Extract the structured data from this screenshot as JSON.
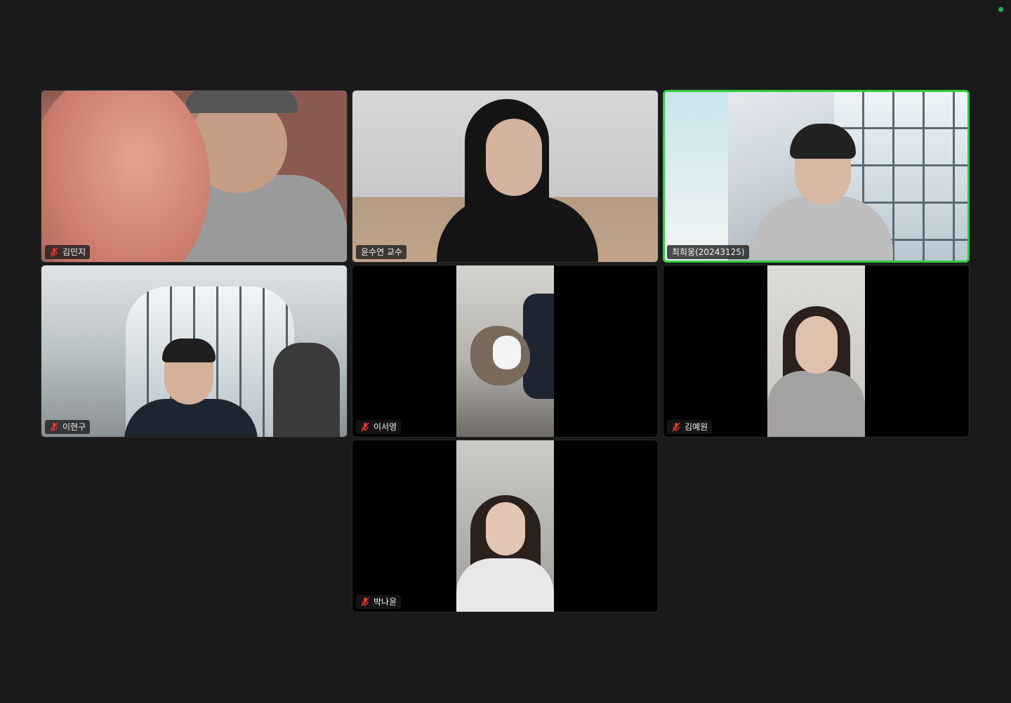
{
  "meeting": {
    "status_color": "#22b14c",
    "active_speaker_color": "#2ecc40",
    "mute_icon_color": "#e8372c"
  },
  "participants": [
    {
      "name": "김민지",
      "muted": true,
      "icon": "muted-mic-icon"
    },
    {
      "name": "윤수연 교수",
      "muted": false
    },
    {
      "name": "최희웅(20243125)",
      "muted": false,
      "active_speaker": true
    },
    {
      "name": "이현구",
      "muted": true,
      "icon": "muted-mic-icon"
    },
    {
      "name": "이서영",
      "muted": true,
      "icon": "muted-mic-icon"
    },
    {
      "name": "김예원",
      "muted": true,
      "icon": "muted-mic-icon"
    },
    {
      "name": "박나윤",
      "muted": true,
      "icon": "muted-mic-icon"
    }
  ]
}
